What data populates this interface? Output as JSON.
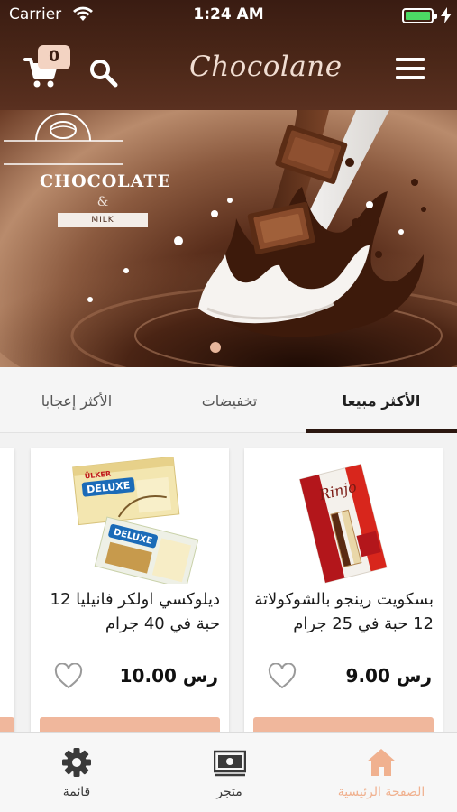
{
  "status_bar": {
    "carrier": "Carrier",
    "time": "1:24 AM",
    "battery_level": 1.0
  },
  "header": {
    "cart_count": "0",
    "brand": "Chocolane"
  },
  "banner": {
    "logo_title": "CHOCOLATE",
    "logo_amp": "&",
    "logo_ribbon": "MILK",
    "page_count": 1,
    "active_page": 0
  },
  "tabs": [
    {
      "label": "الأكثر مبيعا",
      "active": true
    },
    {
      "label": "تخفيضات",
      "active": false
    },
    {
      "label": "الأكثر إعجابا",
      "active": false
    }
  ],
  "products": [
    {
      "name": "بسكويت رينجو بالشوكولاتة 12 حبة في 25 جرام",
      "price": "9.00",
      "currency": "رس"
    },
    {
      "name": "ديلوكسي اولكر فانيليا 12 حبة في 40 جرام",
      "price": "10.00",
      "currency": "رس"
    }
  ],
  "packaging_text": {
    "ulker": "ÜLKER",
    "deluxe": "DELUXE",
    "ringo": "Rinjo"
  },
  "bottom_nav": [
    {
      "label": "الصفحة الرئيسية",
      "icon": "home-icon",
      "active": true
    },
    {
      "label": "متجر",
      "icon": "store-icon",
      "active": false
    },
    {
      "label": "قائمة",
      "icon": "gear-icon",
      "active": false
    }
  ],
  "colors": {
    "header_bg": "#4b2718",
    "accent": "#f0b18f",
    "badge_bg": "#f3d3c2",
    "tab_indicator": "#2b1710"
  }
}
